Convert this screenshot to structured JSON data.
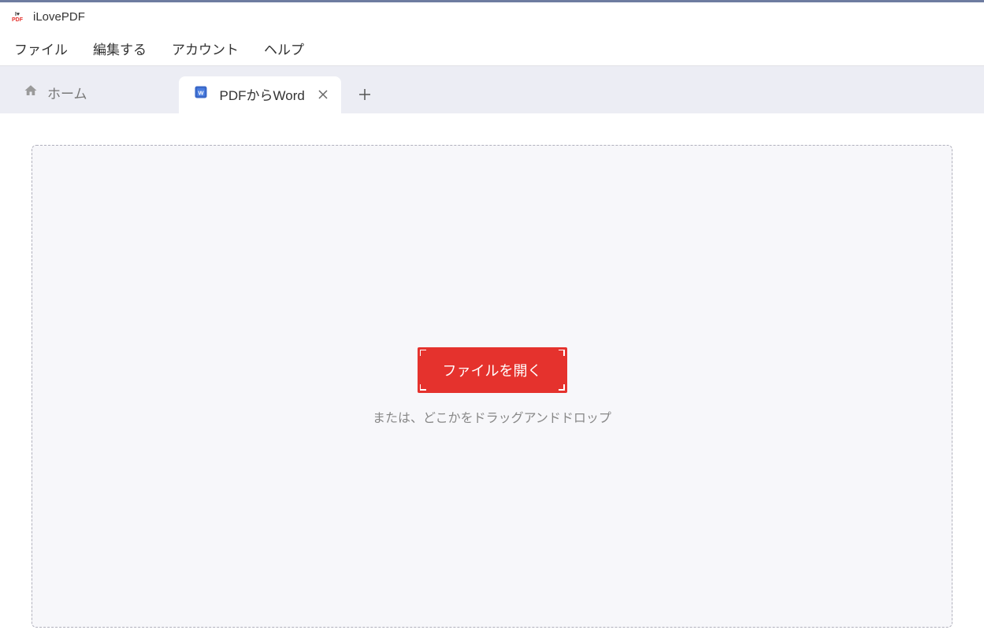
{
  "app": {
    "title": "iLovePDF"
  },
  "menu": {
    "items": [
      "ファイル",
      "編集する",
      "アカウント",
      "ヘルプ"
    ]
  },
  "tabs": {
    "home_label": "ホーム",
    "active": {
      "label": "PDFからWord"
    }
  },
  "dropzone": {
    "button_label": "ファイルを開く",
    "hint": "または、どこかをドラッグアンドドロップ"
  }
}
